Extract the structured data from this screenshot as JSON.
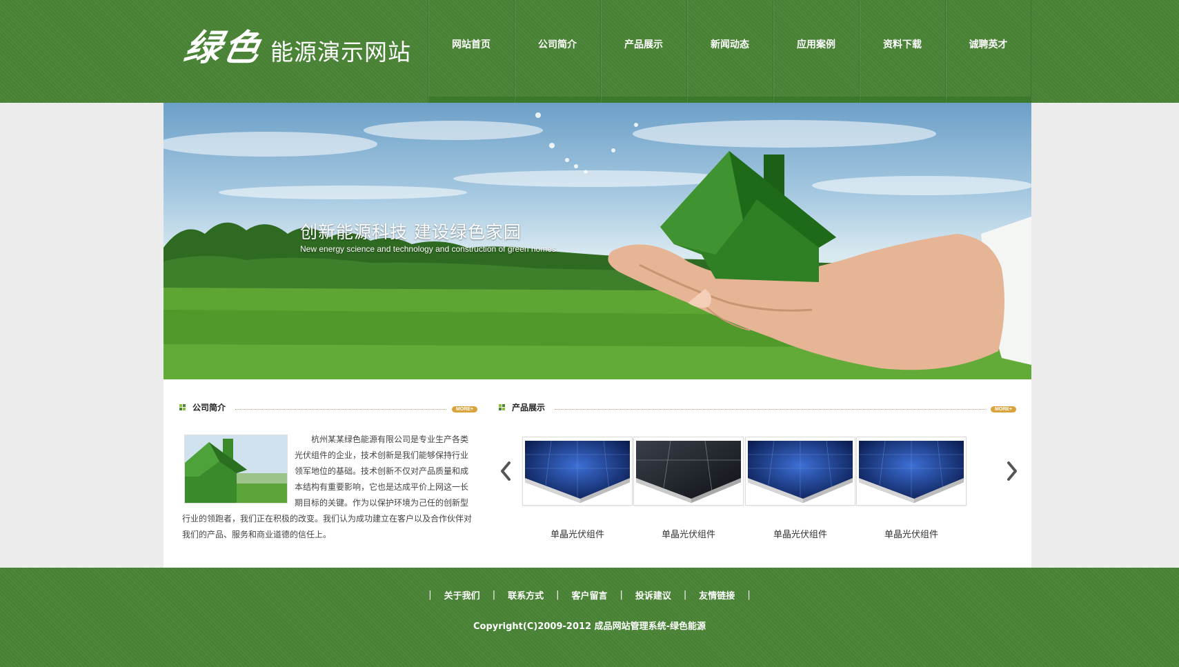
{
  "brand": {
    "logo_script": "绿色",
    "logo_text": "能源演示网站"
  },
  "nav": {
    "items": [
      {
        "label": "网站首页"
      },
      {
        "label": "公司简介"
      },
      {
        "label": "产品展示"
      },
      {
        "label": "新闻动态"
      },
      {
        "label": "应用案例"
      },
      {
        "label": "资料下载"
      },
      {
        "label": "诚聘英才"
      }
    ]
  },
  "banner": {
    "slogan_cn": "创新能源科技  建设绿色家园",
    "slogan_en": "New energy science and technology and construction of green homes"
  },
  "about": {
    "title": "公司简介",
    "more_label": "MORE+",
    "text": "杭州某某绿色能源有限公司是专业生产各类光伏组件的企业，技术创新是我们能够保持行业领军地位的基础。技术创新不仅对产品质量和成本结构有重要影响，它也是达成平价上网这一长期目标的关键。作为以保护环境为己任的创新型行业的领跑者，我们正在积极的改变。我们认为成功建立在客户以及合作伙伴对我们的产品、服务和商业道德的信任上。"
  },
  "products": {
    "title": "产品展示",
    "more_label": "MORE+",
    "items": [
      {
        "name": "单晶光伏组件",
        "variant": "blue"
      },
      {
        "name": "单晶光伏组件",
        "variant": "dark"
      },
      {
        "name": "单晶光伏组件",
        "variant": "blue"
      },
      {
        "name": "单晶光伏组件",
        "variant": "blue"
      }
    ],
    "prev_icon": "chevron-left-icon",
    "next_icon": "chevron-right-icon"
  },
  "footer": {
    "links": [
      {
        "label": "关于我们"
      },
      {
        "label": "联系方式"
      },
      {
        "label": "客户留言"
      },
      {
        "label": "投诉建议"
      },
      {
        "label": "友情链接"
      }
    ],
    "separator": "|",
    "copyright": "Copyright(C)2009-2012 成品网站管理系统-绿色能源"
  },
  "colors": {
    "brand_green": "#4a8436",
    "accent_gold": "#d9a23a"
  }
}
